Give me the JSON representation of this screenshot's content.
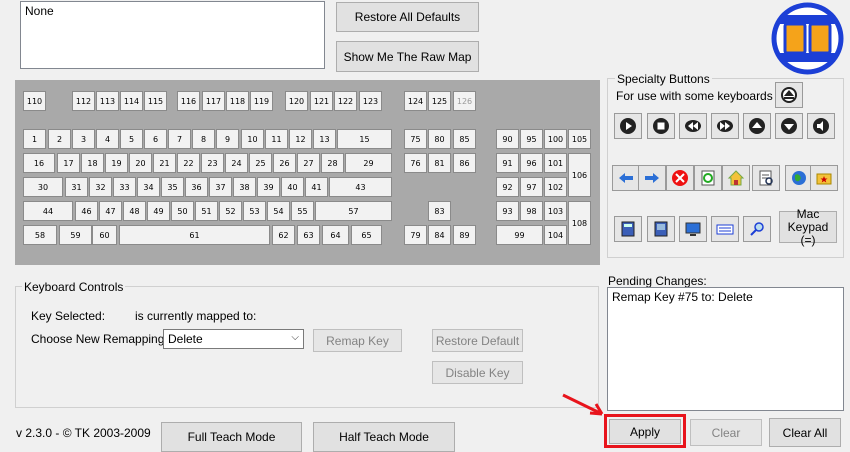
{
  "top": {
    "list_text": "None",
    "restore_all_label": "Restore All Defaults",
    "raw_map_label": "Show Me The Raw Map"
  },
  "keyboard": {
    "fn_row": [
      "110",
      "112",
      "113",
      "114",
      "115",
      "116",
      "117",
      "118",
      "119",
      "120",
      "121",
      "122",
      "123",
      "124",
      "125",
      "126"
    ],
    "row1": [
      "1",
      "2",
      "3",
      "4",
      "5",
      "6",
      "7",
      "8",
      "9",
      "10",
      "11",
      "12",
      "13",
      "15"
    ],
    "row2": [
      "16",
      "17",
      "18",
      "19",
      "20",
      "21",
      "22",
      "23",
      "24",
      "25",
      "26",
      "27",
      "28",
      "29"
    ],
    "row3": [
      "30",
      "31",
      "32",
      "33",
      "34",
      "35",
      "36",
      "37",
      "38",
      "39",
      "40",
      "41",
      "43"
    ],
    "row4": [
      "44",
      "46",
      "47",
      "48",
      "49",
      "50",
      "51",
      "52",
      "53",
      "54",
      "55",
      "57"
    ],
    "row5": [
      "58",
      "59",
      "60",
      "61",
      "62",
      "63",
      "64",
      "65"
    ],
    "nav": [
      "75",
      "80",
      "85",
      "76",
      "81",
      "86",
      "83",
      "79",
      "84",
      "89"
    ],
    "numpad": [
      "90",
      "95",
      "100",
      "105",
      "91",
      "96",
      "101",
      "92",
      "97",
      "102",
      "106",
      "93",
      "98",
      "103",
      "99",
      "104",
      "108"
    ]
  },
  "specialty": {
    "title": "Specialty Buttons",
    "subtitle": "For use with some keyboards",
    "mac_keypad_label": "Mac Keypad (=)"
  },
  "controls": {
    "title": "Keyboard Controls",
    "key_selected_label": "Key Selected:",
    "mapped_to_label": "is currently mapped to:",
    "choose_label": "Choose New Remapping",
    "remap_value": "Delete",
    "remap_key_label": "Remap Key",
    "restore_default_label": "Restore Default",
    "disable_key_label": "Disable Key"
  },
  "pending": {
    "title": "Pending Changes:",
    "items": [
      "Remap Key #75 to: Delete"
    ]
  },
  "footer": {
    "version": "v 2.3.0 - © TK 2003-2009",
    "full_teach_label": "Full Teach Mode",
    "half_teach_label": "Half Teach Mode",
    "apply_label": "Apply",
    "clear_label": "Clear",
    "clear_all_label": "Clear All"
  },
  "colors": {
    "highlight": "#e8141c",
    "logo_blue": "#1c3fd6",
    "logo_orange": "#f5a31a"
  }
}
